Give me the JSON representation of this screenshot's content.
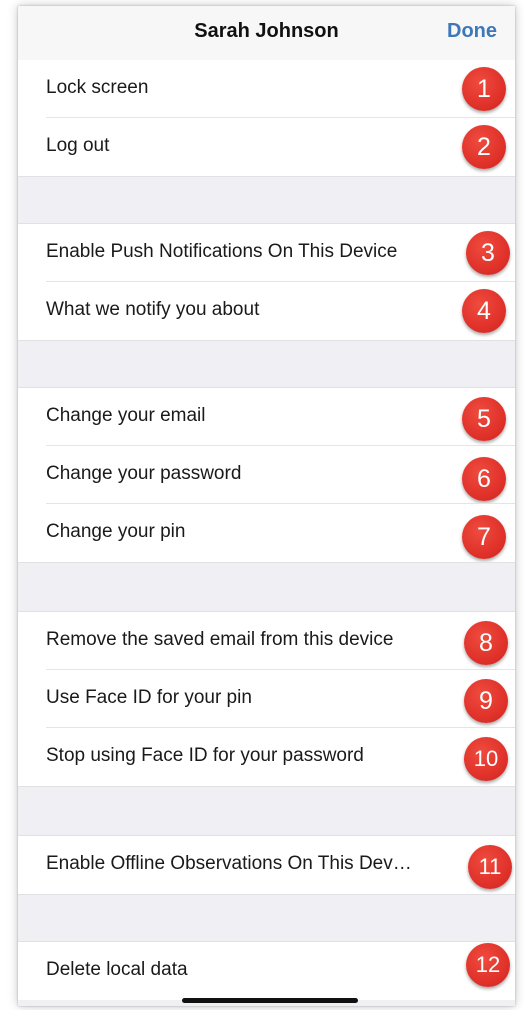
{
  "nav": {
    "title": "Sarah Johnson",
    "done_label": "Done"
  },
  "groups": [
    {
      "items": [
        {
          "label": "Lock screen",
          "badge": "1"
        },
        {
          "label": "Log out",
          "badge": "2"
        }
      ]
    },
    {
      "items": [
        {
          "label": "Enable Push Notifications On This Device",
          "badge": "3"
        },
        {
          "label": "What we notify you about",
          "badge": "4"
        }
      ]
    },
    {
      "items": [
        {
          "label": "Change your email",
          "badge": "5"
        },
        {
          "label": "Change your password",
          "badge": "6"
        },
        {
          "label": "Change your pin",
          "badge": "7"
        }
      ]
    },
    {
      "items": [
        {
          "label": "Remove the saved email from this device",
          "badge": "8"
        },
        {
          "label": "Use Face ID for your pin",
          "badge": "9"
        },
        {
          "label": "Stop using Face ID for your password",
          "badge": "10"
        }
      ]
    },
    {
      "items": [
        {
          "label": "Enable Offline Observations On This Dev…",
          "badge": "11"
        }
      ]
    },
    {
      "items": [
        {
          "label": "Delete local data",
          "badge": "12"
        }
      ]
    }
  ],
  "colors": {
    "accent": "#3d78b8",
    "badge": "#e0322a",
    "background": "#efeff4"
  }
}
